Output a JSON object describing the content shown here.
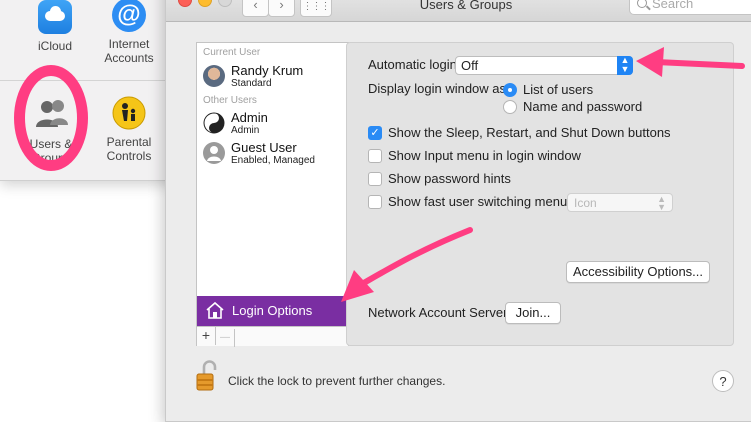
{
  "background_window": {
    "prefs": [
      {
        "label": "iCloud",
        "icon": "icloud-icon"
      },
      {
        "label": "Internet Accounts",
        "icon": "at-sign-icon"
      },
      {
        "label": "Users & Groups",
        "icon": "users-icon"
      },
      {
        "label": "Parental Controls",
        "icon": "parental-controls-icon"
      }
    ]
  },
  "window": {
    "title": "Users & Groups",
    "search_placeholder": "Search"
  },
  "sidebar": {
    "current_user_header": "Current User",
    "current_user": {
      "name": "Randy Krum",
      "role": "Standard"
    },
    "other_users_header": "Other Users",
    "other_users": [
      {
        "name": "Admin",
        "role": "Admin"
      },
      {
        "name": "Guest User",
        "role": "Enabled, Managed"
      }
    ],
    "login_options_label": "Login Options",
    "add_symbol": "+",
    "remove_symbol": "—"
  },
  "login_options": {
    "automatic_login_label": "Automatic login:",
    "automatic_login_value": "Off",
    "display_as_label": "Display login window as:",
    "display_options": [
      {
        "label": "List of users",
        "selected": true
      },
      {
        "label": "Name and password",
        "selected": false
      }
    ],
    "checkboxes": [
      {
        "label": "Show the Sleep, Restart, and Shut Down buttons",
        "checked": true
      },
      {
        "label": "Show Input menu in login window",
        "checked": false
      },
      {
        "label": "Show password hints",
        "checked": false
      },
      {
        "label": "Show fast user switching menu as",
        "checked": false
      }
    ],
    "fast_switch_value": "Icon",
    "accessibility_button": "Accessibility Options...",
    "network_server_label": "Network Account Server:",
    "join_button": "Join..."
  },
  "footer": {
    "lock_text": "Click the lock to prevent further changes.",
    "help_symbol": "?"
  },
  "colors": {
    "accent_blue": "#2a8bf5",
    "selection_purple": "#7a2ea2",
    "annotation_pink": "#ff3d82"
  }
}
